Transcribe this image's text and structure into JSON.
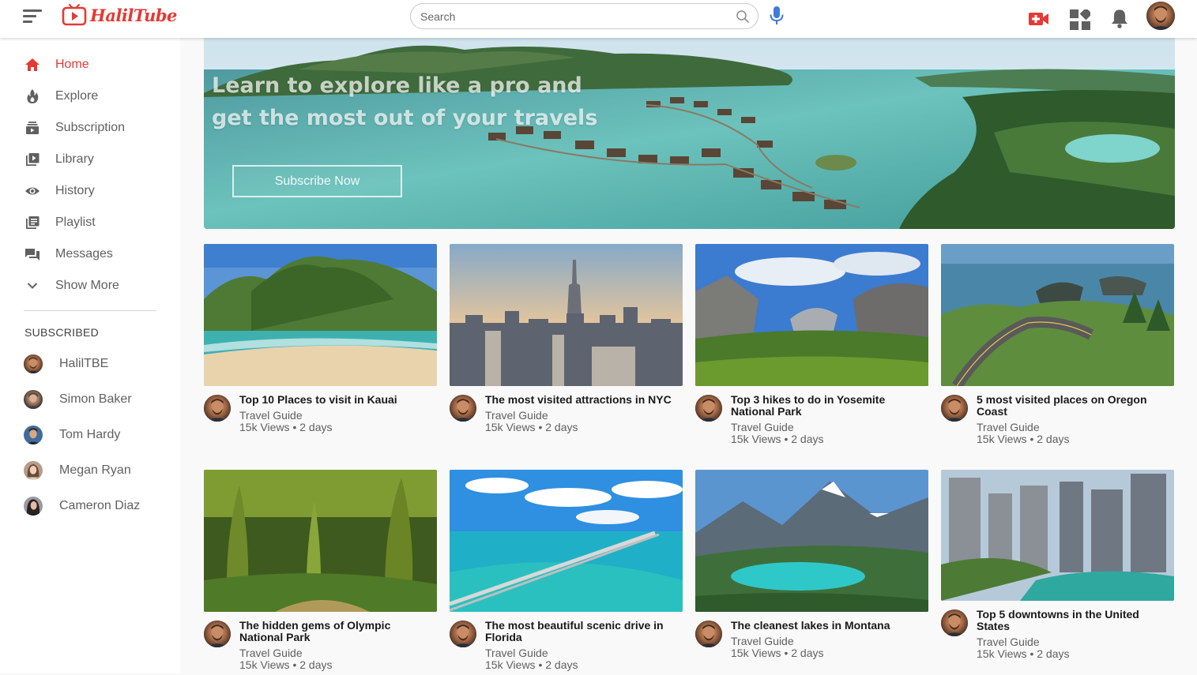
{
  "app": {
    "name": "HalilTube"
  },
  "search": {
    "placeholder": "Search"
  },
  "sidebar": {
    "items": [
      {
        "label": "Home",
        "icon": "home-icon"
      },
      {
        "label": "Explore",
        "icon": "flame-icon"
      },
      {
        "label": "Subscription",
        "icon": "subscription-icon"
      },
      {
        "label": "Library",
        "icon": "library-icon"
      },
      {
        "label": "History",
        "icon": "eye-icon"
      },
      {
        "label": "Playlist",
        "icon": "playlist-icon"
      },
      {
        "label": "Messages",
        "icon": "messages-icon"
      },
      {
        "label": "Show More",
        "icon": "chevron-down-icon"
      }
    ],
    "subscribed_heading": "SUBSCRIBED",
    "subscribed": [
      "HalilTBE",
      "Simon Baker",
      "Tom Hardy",
      "Megan Ryan",
      "Cameron Diaz"
    ]
  },
  "banner": {
    "title": "Learn to explore like a pro and get the most out of your travels",
    "button": "Subscribe Now"
  },
  "videos": [
    {
      "title": "Top 10 Places to visit in Kauai",
      "channel": "Travel Guide",
      "stats": "15k Views • 2 days"
    },
    {
      "title": "The most visited attractions in NYC",
      "channel": "Travel Guide",
      "stats": "15k Views • 2 days"
    },
    {
      "title": "Top 3 hikes to do in Yosemite National Park",
      "channel": "Travel Guide",
      "stats": "15k Views • 2 days"
    },
    {
      "title": "5 most visited places on Oregon Coast",
      "channel": "Travel Guide",
      "stats": "15k Views • 2 days"
    },
    {
      "title": "The hidden gems of Olympic National Park",
      "channel": "Travel Guide",
      "stats": "15k Views • 2 days"
    },
    {
      "title": "The most beautiful scenic drive in Florida",
      "channel": "Travel Guide",
      "stats": "15k Views • 2 days"
    },
    {
      "title": "The cleanest lakes in Montana",
      "channel": "Travel Guide",
      "stats": "15k Views • 2 days"
    },
    {
      "title": "Top 5 downtowns in the United States",
      "channel": "Travel Guide",
      "stats": "15k Views • 2 days"
    }
  ],
  "colors": {
    "accent": "#e53935",
    "text_secondary": "#606060"
  }
}
